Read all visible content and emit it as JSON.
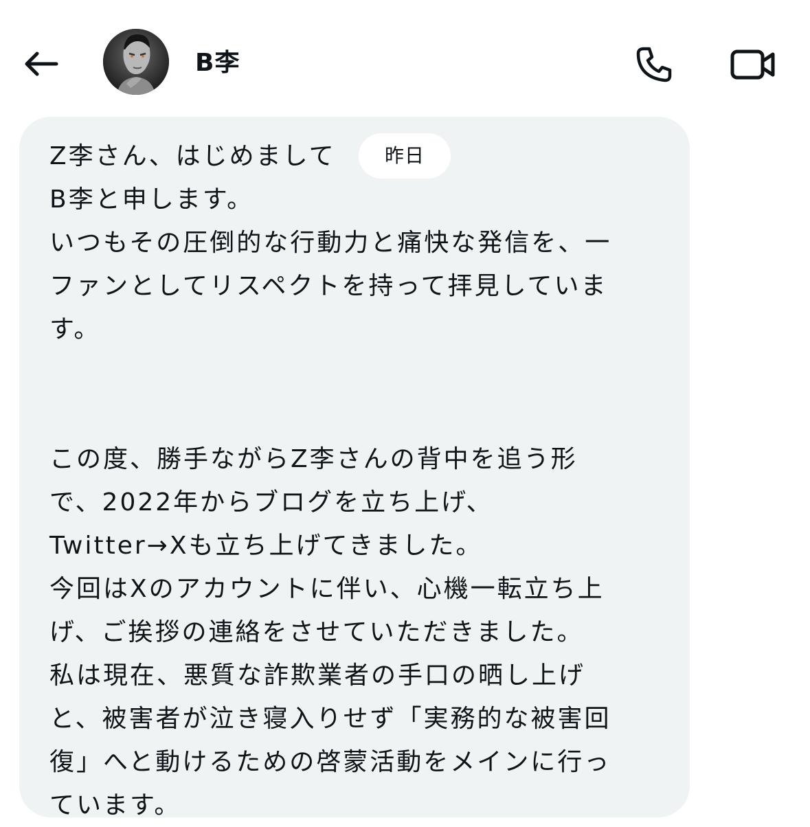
{
  "header": {
    "contact_name": "B李",
    "back_icon": "arrow-left-icon",
    "call_icon": "phone-icon",
    "video_icon": "video-camera-icon"
  },
  "message": {
    "timestamp": "昨日",
    "lines": [
      "Z李さん、はじめまして",
      "B李と申します。",
      "いつもその圧倒的な行動力と痛快な発信を、一",
      "ファンとしてリスペクトを持って拝見していま",
      "す。",
      "この度、勝手ながらZ李さんの背中を追う形",
      "で、2022年からブログを立ち上げ、",
      "Twitter→Xも立ち上げてきました。",
      "今回はXのアカウントに伴い、心機一転立ち上",
      "げ、ご挨拶の連絡をさせていただきました。",
      "私は現在、悪質な詐欺業者の手口の晒し上げ",
      "と、被害者が泣き寝入りせず「実務的な被害回",
      "復」へと動けるための啓蒙活動をメインに行っ",
      "ています。"
    ],
    "bubble_color": "#eff3f4"
  }
}
